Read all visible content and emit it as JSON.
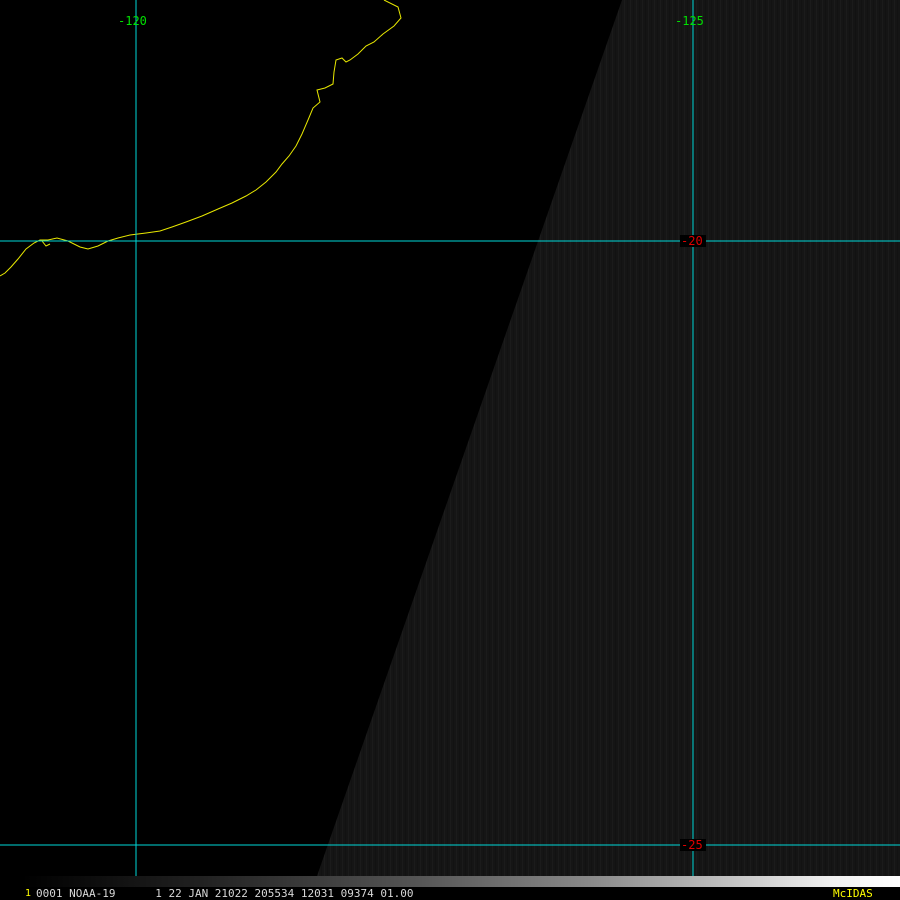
{
  "map": {
    "longitude_labels": [
      {
        "value": "-120"
      },
      {
        "value": "-125"
      }
    ],
    "latitude_labels": [
      {
        "value": "-20"
      },
      {
        "value": "-25"
      }
    ],
    "colors": {
      "grid_lines": "#00d8d8",
      "coastline": "#e8e800",
      "longitude_label": "#00e000",
      "latitude_label": "#e00000",
      "swath": "#161616",
      "background": "#000000"
    }
  },
  "status_bar": {
    "frame_number": "1",
    "info": "0001 NOAA-19      1 22 JAN 21022 205534 12031 09374 01.00",
    "logo": "McIDAS"
  }
}
